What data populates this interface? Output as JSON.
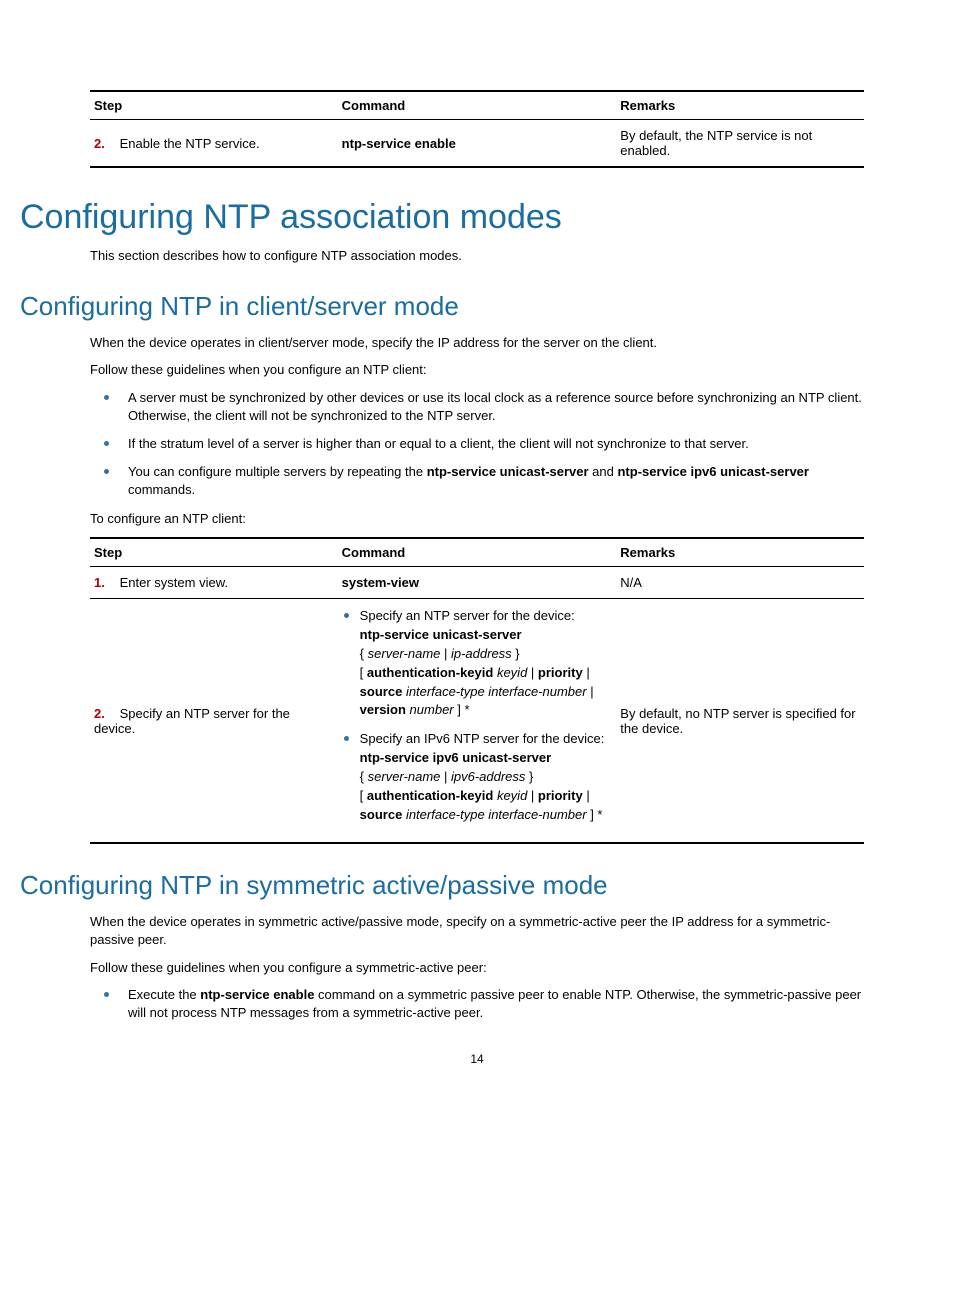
{
  "table1": {
    "headers": {
      "step": "Step",
      "command": "Command",
      "remarks": "Remarks"
    },
    "row": {
      "num": "2.",
      "step": "Enable the NTP service.",
      "command": "ntp-service enable",
      "remarks": "By default, the NTP service is not enabled."
    }
  },
  "h1": "Configuring NTP association modes",
  "p_intro": "This section describes how to configure NTP association modes.",
  "h2a": "Configuring NTP in client/server mode",
  "p_cs1": "When the device operates in client/server mode, specify the IP address for the server on the client.",
  "p_cs2": "Follow these guidelines when you configure an NTP client:",
  "bul_cs": {
    "b1": "A server must be synchronized by other devices or use its local clock as a reference source before synchronizing an NTP client. Otherwise, the client will not be synchronized to the NTP server.",
    "b2": "If the stratum level of a server is higher than or equal to a client, the client will not synchronize to that server.",
    "b3_pre": "You can configure multiple servers by repeating the ",
    "b3_cmd1": "ntp-service unicast-server",
    "b3_mid": " and ",
    "b3_cmd2": "ntp-service ipv6 unicast-server",
    "b3_post": " commands."
  },
  "p_cs3": "To configure an NTP client:",
  "table2": {
    "headers": {
      "step": "Step",
      "command": "Command",
      "remarks": "Remarks"
    },
    "row1": {
      "num": "1.",
      "step": "Enter system view.",
      "command": "system-view",
      "remarks": "N/A"
    },
    "row2": {
      "num": "2.",
      "step": "Specify an NTP server for the device.",
      "cmd_li1": {
        "intro": "Specify an NTP server for the device:",
        "cmd": "ntp-service unicast-server",
        "arg1": "server-name",
        "sep1": " | ",
        "arg2": "ip-address",
        "brace_close": " }",
        "lb": "[ ",
        "auth": "authentication-keyid",
        "sp1": " ",
        "keyid": "keyid",
        "sep2": " | ",
        "prio": "priority",
        "sep3": " | ",
        "src": "source",
        "sp2": " ",
        "iftype": "interface-type interface-number",
        "sep4": " | ",
        "ver": "version",
        "sp3": " ",
        "num": "number",
        "end": " ] *"
      },
      "cmd_li2": {
        "intro": "Specify an IPv6 NTP server for the device:",
        "cmd": "ntp-service ipv6 unicast-server",
        "arg1": "server-name",
        "sep1": " | ",
        "arg2": "ipv6-address",
        "brace_close": " }",
        "lb": "[ ",
        "auth": "authentication-keyid",
        "sp1": " ",
        "keyid": "keyid",
        "sep2": " | ",
        "prio": "priority",
        "sep3": " | ",
        "src": "source",
        "sp2": " ",
        "iftype": "interface-type interface-number",
        "end": " ] *"
      },
      "remarks": "By default, no NTP server is specified for the device."
    }
  },
  "h2b": "Configuring NTP in symmetric active/passive mode",
  "p_sp1": "When the device operates in symmetric active/passive mode, specify on a symmetric-active peer the IP address for a symmetric-passive peer.",
  "p_sp2": "Follow these guidelines when you configure a symmetric-active peer:",
  "bul_sp": {
    "b1_pre": "Execute the ",
    "b1_cmd": "ntp-service enable",
    "b1_post": " command on a symmetric passive peer to enable NTP. Otherwise, the symmetric-passive peer will not process NTP messages from a symmetric-active peer."
  },
  "pagenum": "14"
}
